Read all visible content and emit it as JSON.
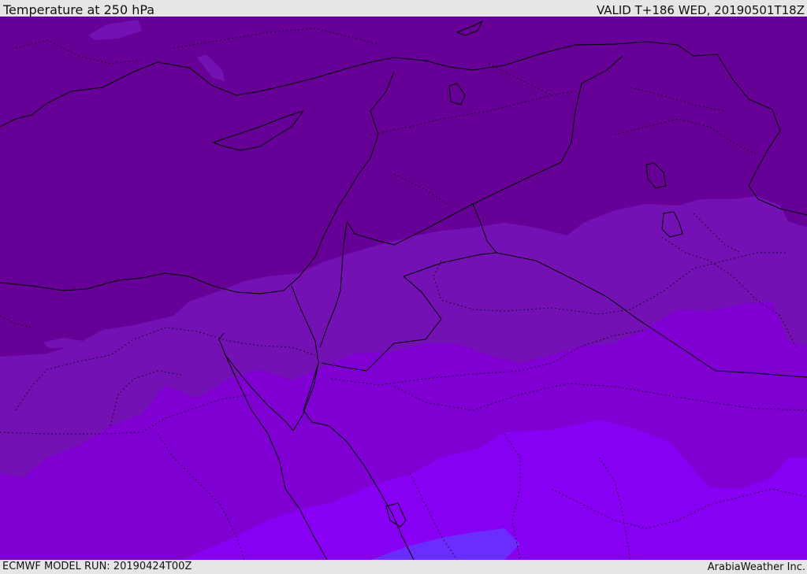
{
  "header": {
    "title": "Temperature at 250 hPa",
    "valid": "VALID T+186 WED, 20190501T18Z"
  },
  "footer": {
    "model_run": "ECMWF MODEL RUN: 20190424T00Z",
    "credit": "ArabiaWeather Inc."
  },
  "colors": {
    "band_1": "#660096",
    "band_2": "#7411b4",
    "band_3": "#8000d3",
    "band_4": "#8800f4",
    "band_5": "#6b2cff",
    "border": "#000000"
  }
}
